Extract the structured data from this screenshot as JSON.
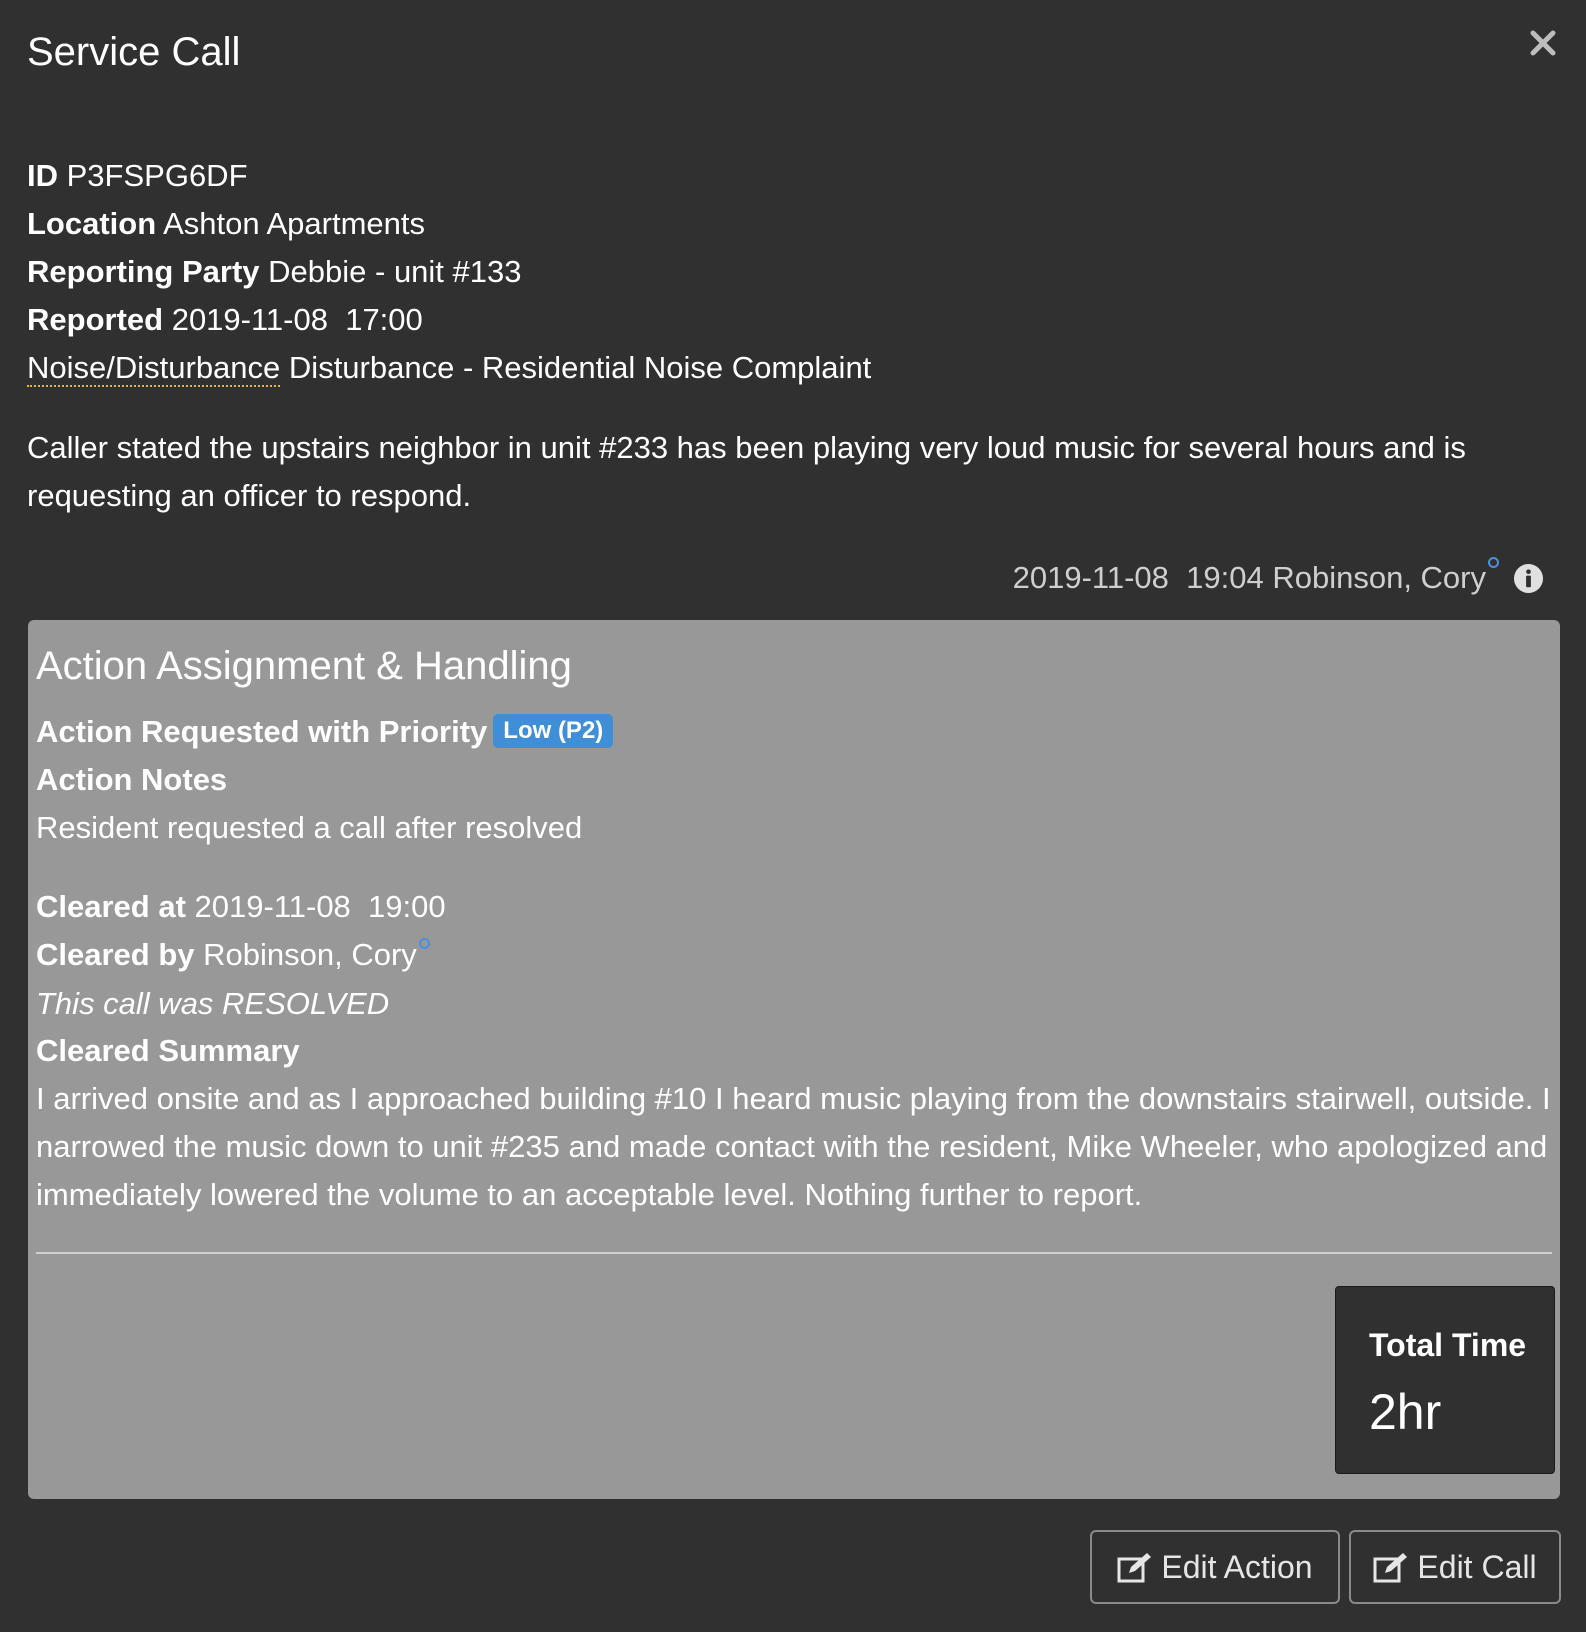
{
  "modal": {
    "title": "Service Call",
    "close_icon": "close-icon"
  },
  "call": {
    "id_label": "ID",
    "id_value": "P3FSPG6DF",
    "location_label": "Location",
    "location_value": "Ashton Apartments",
    "reporting_party_label": "Reporting Party",
    "reporting_party_value": "Debbie - unit #133",
    "reported_label": "Reported",
    "reported_value": "2019-11-08  17:00",
    "category": "Noise/Disturbance",
    "category_detail": "Disturbance - Residential Noise Complaint",
    "description": "Caller stated the upstairs neighbor in unit #233 has been playing very loud music for several hours and is requesting an officer to respond.",
    "meta_timestamp": "2019-11-08  19:04",
    "meta_user": "Robinson, Cory"
  },
  "action": {
    "title": "Action Assignment & Handling",
    "requested_label": "Action Requested with Priority",
    "priority_badge": "Low (P2)",
    "notes_label": "Action Notes",
    "notes_value": "Resident requested a call after resolved",
    "cleared_at_label": "Cleared at",
    "cleared_at_value": "2019-11-08  19:00",
    "cleared_by_label": "Cleared by",
    "cleared_by_value": "Robinson, Cory",
    "resolution_note": "This call was RESOLVED",
    "summary_label": "Cleared Summary",
    "summary_value": "I arrived onsite and as I approached building #10 I heard music playing from the downstairs stairwell, outside. I narrowed the music down to unit #235 and made contact with the resident, Mike Wheeler, who apologized and immediately lowered the volume to an acceptable level. Nothing further to report.",
    "total_time_label": "Total Time",
    "total_time_value": "2hr"
  },
  "buttons": {
    "edit_action": "Edit Action",
    "edit_call": "Edit Call"
  },
  "colors": {
    "background": "#303030",
    "panel": "#989898",
    "badge": "#3e8ed8"
  }
}
